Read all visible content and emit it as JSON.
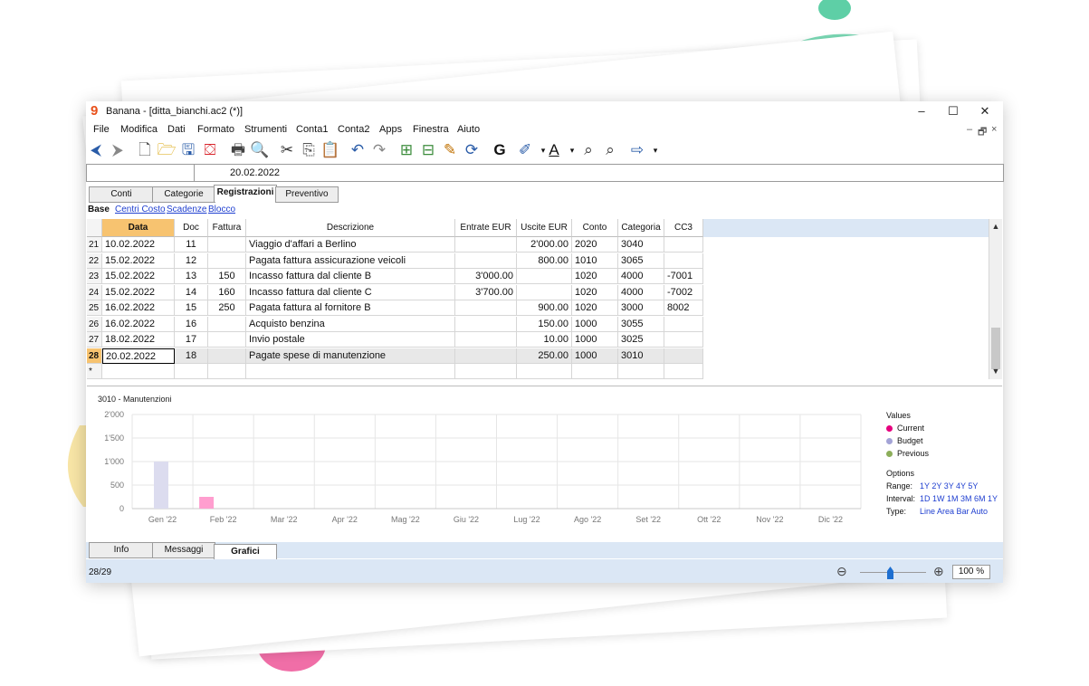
{
  "window": {
    "title": "Banana - [ditta_bianchi.ac2 (*)]"
  },
  "menu": [
    "File",
    "Modifica",
    "Dati",
    "Formato",
    "Strumenti",
    "Conta1",
    "Conta2",
    "Apps",
    "Finestra",
    "Aiuto"
  ],
  "cell_bar": {
    "value": "20.02.2022"
  },
  "top_tabs": [
    "Conti",
    "Categorie",
    "Registrazioni",
    "Preventivo"
  ],
  "views": [
    "Base",
    "Centri Costo",
    "Scadenze",
    "Blocco"
  ],
  "table": {
    "headers": [
      "Data",
      "Doc",
      "Fattura",
      "Descrizione",
      "Entrate EUR",
      "Uscite EUR",
      "Conto",
      "Categoria",
      "CC3"
    ],
    "rows": [
      [
        "21",
        "10.02.2022",
        "11",
        "",
        "Viaggio d'affari a Berlino",
        "",
        "2'000.00",
        "2020",
        "3040",
        ""
      ],
      [
        "22",
        "15.02.2022",
        "12",
        "",
        "Pagata fattura assicurazione veicoli",
        "",
        "800.00",
        "1010",
        "3065",
        ""
      ],
      [
        "23",
        "15.02.2022",
        "13",
        "150",
        "Incasso fattura dal cliente B",
        "3'000.00",
        "",
        "1020",
        "4000",
        "-7001"
      ],
      [
        "24",
        "15.02.2022",
        "14",
        "160",
        "Incasso fattura dal cliente C",
        "3'700.00",
        "",
        "1020",
        "4000",
        "-7002"
      ],
      [
        "25",
        "16.02.2022",
        "15",
        "250",
        "Pagata fattura al fornitore B",
        "",
        "900.00",
        "1020",
        "3000",
        "8002"
      ],
      [
        "26",
        "16.02.2022",
        "16",
        "",
        "Acquisto benzina",
        "",
        "150.00",
        "1000",
        "3055",
        ""
      ],
      [
        "27",
        "18.02.2022",
        "17",
        "",
        "Invio postale",
        "",
        "10.00",
        "1000",
        "3025",
        ""
      ],
      [
        "28",
        "20.02.2022",
        "18",
        "",
        "Pagate spese di manutenzione",
        "",
        "250.00",
        "1000",
        "3010",
        ""
      ]
    ],
    "new_row_marker": "*"
  },
  "chart_data": {
    "type": "bar",
    "title": "3010 - Manutenzioni",
    "categories": [
      "Gen '22",
      "Feb '22",
      "Mar '22",
      "Apr '22",
      "Mag '22",
      "Giu '22",
      "Lug '22",
      "Ago '22",
      "Set '22",
      "Ott '22",
      "Nov '22",
      "Dic '22"
    ],
    "series": [
      {
        "name": "Current",
        "color": "#ff9ecf",
        "values": [
          0,
          250,
          0,
          0,
          0,
          0,
          0,
          0,
          0,
          0,
          0,
          0
        ]
      },
      {
        "name": "Budget",
        "color": "#dcdcef",
        "values": [
          1000,
          0,
          0,
          0,
          0,
          0,
          0,
          0,
          0,
          0,
          0,
          0
        ]
      },
      {
        "name": "Previous",
        "color": "#8cae5a",
        "values": [
          0,
          0,
          0,
          0,
          0,
          0,
          0,
          0,
          0,
          0,
          0,
          0
        ]
      }
    ],
    "yticks": [
      "2'000",
      "1'500",
      "1'000",
      "500",
      "0"
    ],
    "ylim": [
      0,
      2000
    ],
    "grid": true,
    "legend_position": "right"
  },
  "legend": {
    "title": "Values",
    "items": [
      {
        "label": "Current",
        "color": "#e6007e"
      },
      {
        "label": "Budget",
        "color": "#a3a3d6"
      },
      {
        "label": "Previous",
        "color": "#8cae5a"
      }
    ]
  },
  "options": {
    "title": "Options",
    "range_label": "Range:",
    "range_values": "1Y 2Y 3Y 4Y 5Y",
    "interval_label": "Interval:",
    "interval_values": "1D 1W 1M 3M 6M 1Y",
    "type_label": "Type:",
    "type_values": "Line Area Bar Auto"
  },
  "bottom_tabs": [
    "Info",
    "Messaggi",
    "Grafici"
  ],
  "status": {
    "position": "28/29",
    "zoom": "100 %",
    "zoom_level_percent": 100
  }
}
